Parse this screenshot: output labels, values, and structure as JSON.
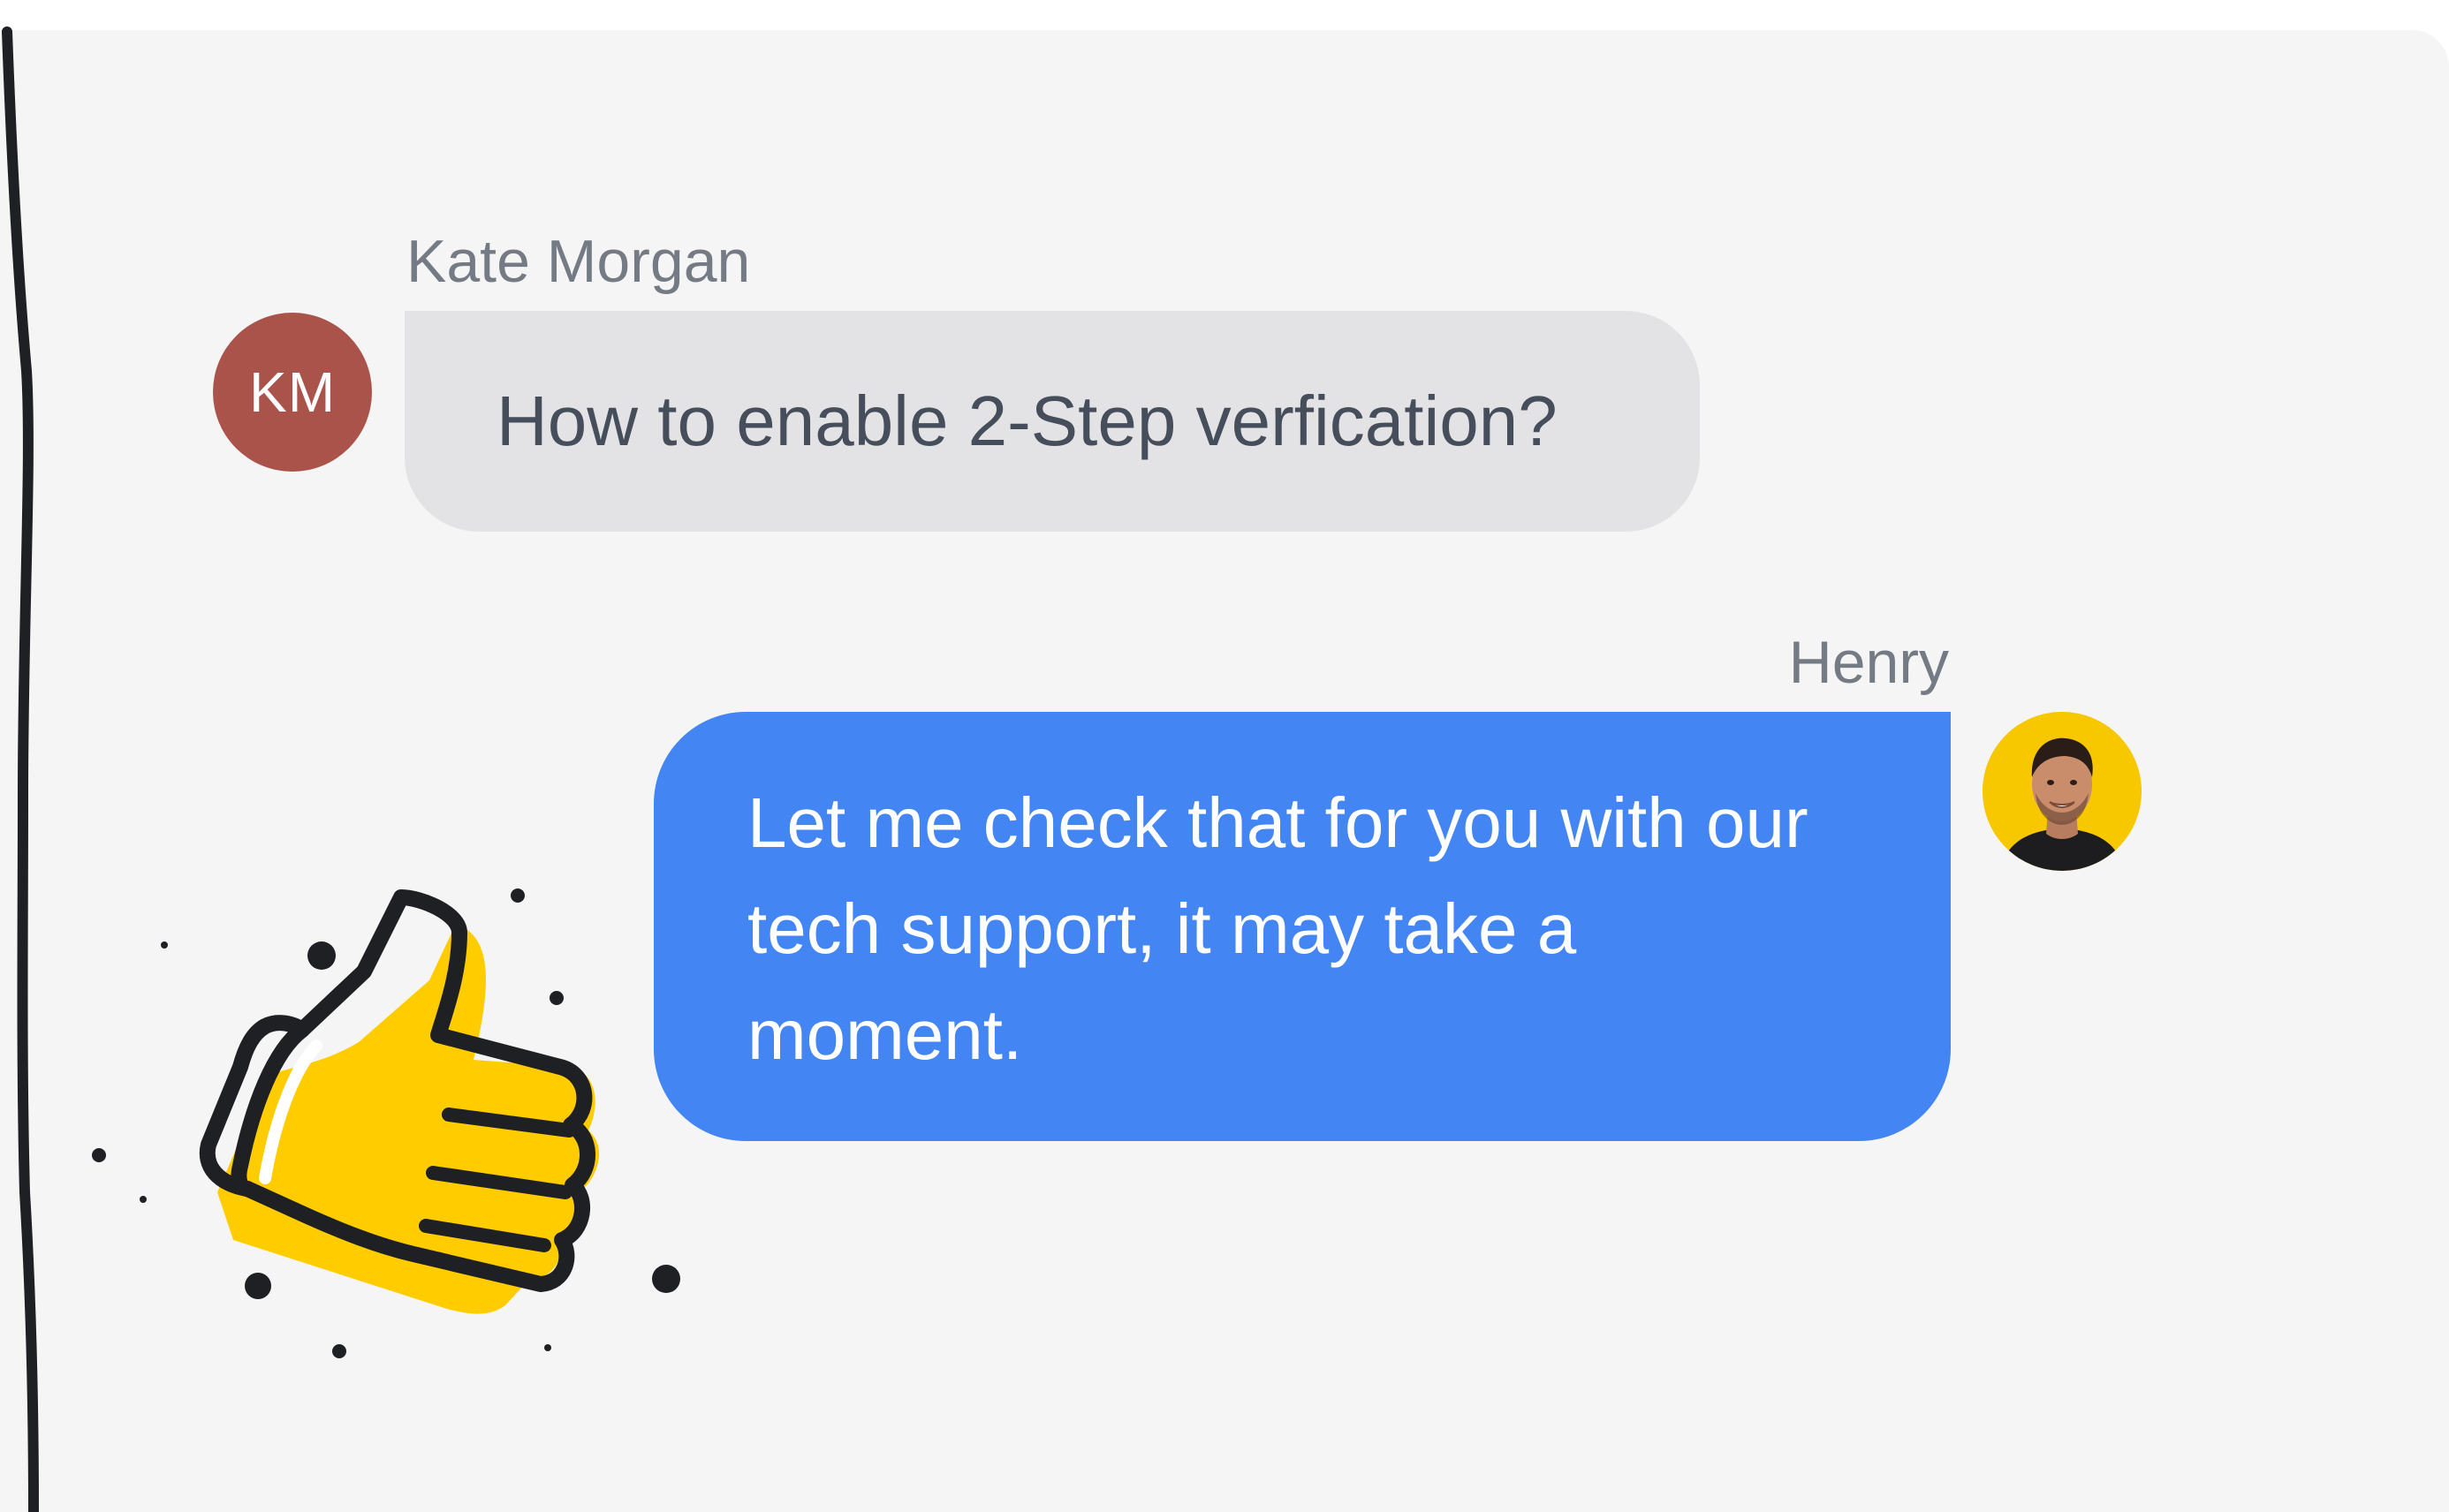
{
  "conversation": {
    "incoming": {
      "sender_name": "Kate Morgan",
      "avatar_initials": "KM",
      "message": "How to enable 2-Step verfication?"
    },
    "outgoing": {
      "sender_name": "Henry",
      "message": "Let me check that for you with our tech support, it may take a moment."
    }
  },
  "decorations": {
    "illustration": "thumbs-up-icon"
  },
  "colors": {
    "panel_background": "#f5f5f5",
    "incoming_bubble": "#e3e3e5",
    "outgoing_bubble": "#4385f2",
    "km_avatar": "#a9534a",
    "accent_yellow": "#ffcc00",
    "name_text": "#757b84"
  }
}
